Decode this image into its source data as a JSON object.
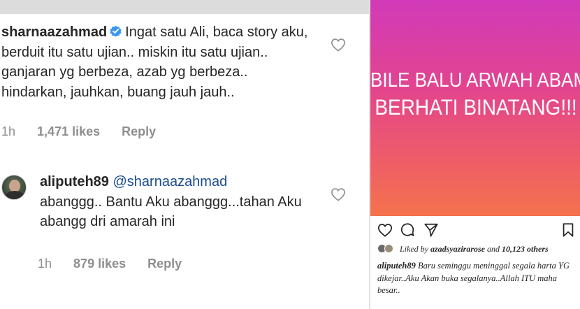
{
  "comments": [
    {
      "username": "sharnaazahmad",
      "verified": true,
      "text": "Ingat satu Ali, baca story aku, berduit itu satu ujian.. miskin itu satu ujian.. ganjaran yg berbeza, azab yg berbeza.. hindarkan, jauhkan, buang jauh jauh..",
      "time": "1h",
      "likes": "1,471 likes",
      "reply": "Reply"
    },
    {
      "username": "aliputeh89",
      "mention": "@sharnaazahmad",
      "text": "abanggg.. Bantu Aku abanggg...tahan Aku abangg dri amarah ini",
      "time": "1h",
      "likes": "879 likes",
      "reply": "Reply"
    }
  ],
  "story": {
    "line1": "BILE BALU ARWAH ABAM",
    "line2": "BERHATI BINATANG!!!",
    "gradient_colors": [
      "#d13ab9",
      "#e2448f",
      "#ee5b6a",
      "#f4734c"
    ]
  },
  "post": {
    "liked_by_prefix": "Liked by",
    "liked_by_user": "azadsyazirarose",
    "liked_by_and": "and",
    "liked_by_count": "10,123 others",
    "caption_user": "aliputeh89",
    "caption_text": "Baru seminggu meninggal segala harta YG dikejar..Aku Akan buka segalanya..Allah ITU maha besar.."
  },
  "icons": {
    "like": "heart-icon",
    "comment": "comment-icon",
    "share": "paper-plane-icon",
    "save": "bookmark-icon",
    "verified": "verified-badge-icon"
  }
}
